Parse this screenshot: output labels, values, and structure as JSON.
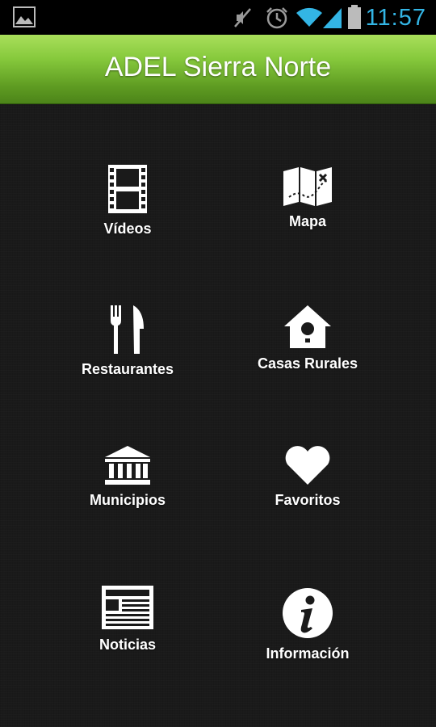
{
  "status_bar": {
    "time": "11:57",
    "icons": [
      "gallery-icon",
      "mute-icon",
      "alarm-icon",
      "wifi-icon",
      "signal-icon",
      "battery-icon"
    ],
    "clock_color": "#33b5e5"
  },
  "header": {
    "title": "ADEL Sierra Norte",
    "accent_color": "#86c93c"
  },
  "menu": {
    "items": [
      {
        "label": "Vídeos",
        "icon": "film-icon"
      },
      {
        "label": "Mapa",
        "icon": "map-icon"
      },
      {
        "label": "Restaurantes",
        "icon": "fork-knife-icon"
      },
      {
        "label": "Casas Rurales",
        "icon": "birdhouse-icon"
      },
      {
        "label": "Municipios",
        "icon": "building-icon"
      },
      {
        "label": "Favoritos",
        "icon": "heart-icon"
      },
      {
        "label": "Noticias",
        "icon": "newspaper-icon"
      },
      {
        "label": "Información",
        "icon": "info-icon"
      }
    ]
  }
}
